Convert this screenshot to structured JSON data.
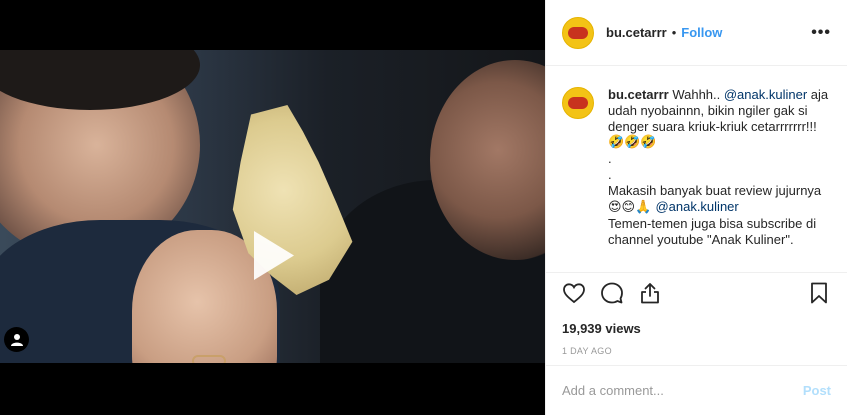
{
  "post": {
    "username": "bu.cetarrr",
    "separator": "•",
    "follow_label": "Follow",
    "more_label": "•••"
  },
  "caption": {
    "username": "bu.cetarrr",
    "line1_pre": " Wahhh.. ",
    "mention1": "@anak.kuliner",
    "line1_post": " aja udah nyobainnn, bikin ngiler gak si denger suara kriuk-kriuk cetarrrrrrr!!!",
    "emoji_row1": "🤣🤣🤣",
    "dot1": ".",
    "dot2": ".",
    "thanks": "Makasih banyak buat review jujurnya",
    "emoji_row2": "😍😊🙏 ",
    "mention2": "@anak.kuliner",
    "subscribe": "Temen-temen juga bisa subscribe di channel youtube \"Anak Kuliner\"."
  },
  "actions": {
    "like_icon": "heart-icon",
    "comment_icon": "speech-bubble-icon",
    "share_icon": "share-icon",
    "save_icon": "bookmark-icon"
  },
  "stats": {
    "views": "19,939 views",
    "time_ago": "1 DAY AGO"
  },
  "comment_box": {
    "placeholder": "Add a comment...",
    "post_label": "Post"
  },
  "colors": {
    "link": "#3897f0",
    "mention": "#003569",
    "post_disabled": "#b2dffc",
    "avatar_bg": "#f3c316"
  }
}
